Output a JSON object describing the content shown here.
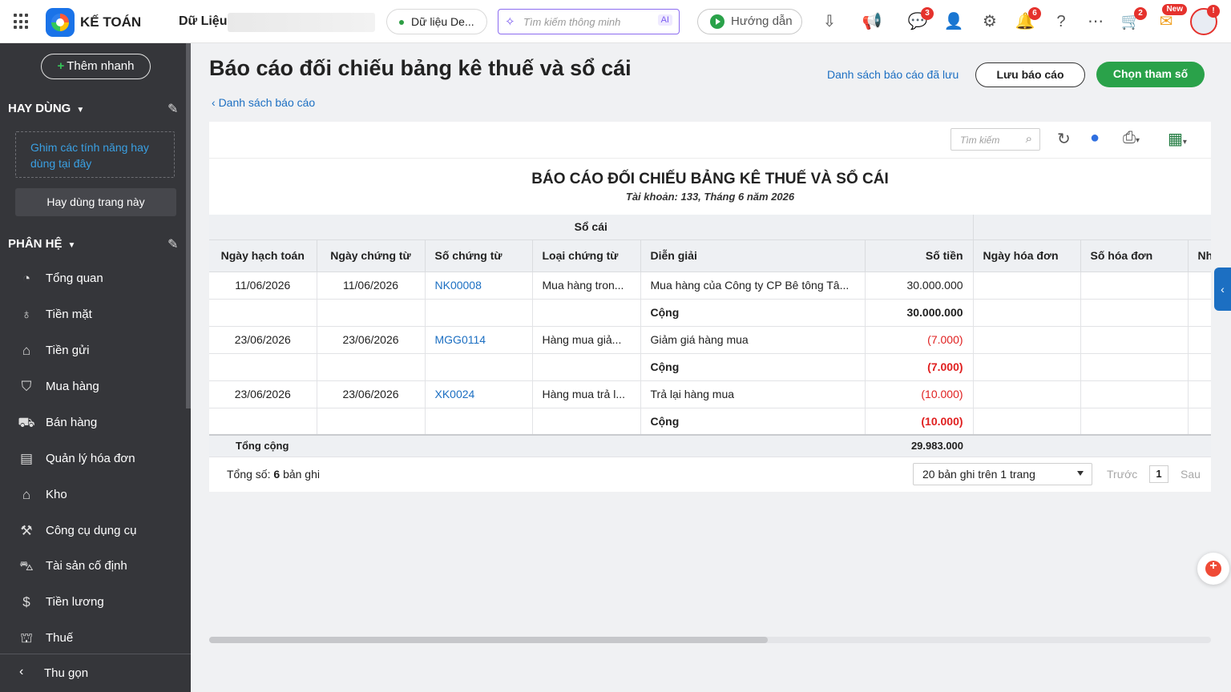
{
  "app": {
    "name": "KẾ TOÁN",
    "data_label": "Dữ Liệu"
  },
  "topbar": {
    "db_select": "Dữ liệu De...",
    "smart_search_placeholder": "Tìm kiếm thông minh",
    "ai_badge": "AI",
    "guide_label": "Hướng dẫn",
    "chat_badge": "3",
    "notif_badge": "6",
    "cart_badge": "2",
    "new_badge": "New",
    "avatar_badge": "!"
  },
  "sidebar": {
    "quick_add": "Thêm nhanh",
    "favorites_title": "HAY DÙNG",
    "pin_hint": "Ghim các tính năng hay dùng tại đây",
    "favor_page_btn": "Hay dùng trang này",
    "modules_title": "PHÂN HỆ",
    "items": [
      {
        "label": "Tổng quan",
        "icon": "chart-pie-icon"
      },
      {
        "label": "Tiền mặt",
        "icon": "money-bag-icon"
      },
      {
        "label": "Tiền gửi",
        "icon": "bank-icon"
      },
      {
        "label": "Mua hàng",
        "icon": "shopping-bag-icon"
      },
      {
        "label": "Bán hàng",
        "icon": "cart-icon"
      },
      {
        "label": "Quản lý hóa đơn",
        "icon": "invoice-icon"
      },
      {
        "label": "Kho",
        "icon": "warehouse-icon"
      },
      {
        "label": "Công cụ dụng cụ",
        "icon": "tools-icon"
      },
      {
        "label": "Tài sản cố định",
        "icon": "car-icon"
      },
      {
        "label": "Tiền lương",
        "icon": "payroll-icon"
      },
      {
        "label": "Thuế",
        "icon": "tax-icon"
      }
    ],
    "collapse": "Thu gọn"
  },
  "page": {
    "title": "Báo cáo đối chiếu bảng kê thuế và sổ cái",
    "back_link": "Danh sách báo cáo",
    "saved_link": "Danh sách báo cáo đã lưu",
    "save_btn": "Lưu báo cáo",
    "param_btn": "Chọn tham số"
  },
  "report": {
    "search_placeholder": "Tìm kiếm",
    "title": "BÁO CÁO ĐỐI CHIẾU BẢNG KÊ THUẾ VÀ SỔ CÁI",
    "subtitle": "Tài khoản: 133, Tháng 6 năm 2026",
    "group_header": "Sổ cái",
    "columns": [
      "Ngày hạch toán",
      "Ngày chứng từ",
      "Số chứng từ",
      "Loại chứng từ",
      "Diễn giải",
      "Số tiền",
      "Ngày hóa đơn",
      "Số hóa đơn",
      "Nh"
    ],
    "rows": [
      [
        "11/06/2026",
        "11/06/2026",
        "NK00008",
        "Mua hàng tron...",
        "Mua hàng của Công ty CP Bê tông Tâ...",
        "30.000.000"
      ],
      [
        "",
        "",
        "",
        "",
        "Cộng",
        "30.000.000"
      ],
      [
        "23/06/2026",
        "23/06/2026",
        "MGG0114",
        "Hàng mua giả...",
        "Giảm giá hàng mua",
        "(7.000)"
      ],
      [
        "",
        "",
        "",
        "",
        "Cộng",
        "(7.000)"
      ],
      [
        "23/06/2026",
        "23/06/2026",
        "XK0024",
        "Hàng mua trả l...",
        "Trả lại hàng mua",
        "(10.000)"
      ],
      [
        "",
        "",
        "",
        "",
        "Cộng",
        "(10.000)"
      ]
    ],
    "total_label": "Tổng cộng",
    "total_value": "29.983.000",
    "pager": {
      "total_prefix": "Tổng số:",
      "total_count": "6",
      "total_suffix": "bản ghi",
      "page_size": "20 bản ghi trên 1 trang",
      "prev": "Trước",
      "page": "1",
      "next": "Sau"
    }
  },
  "colors": {
    "accent_green": "#2aa24a",
    "link_blue": "#1c6fc2",
    "negative_red": "#e02020",
    "sidebar_bg": "#35363a"
  }
}
